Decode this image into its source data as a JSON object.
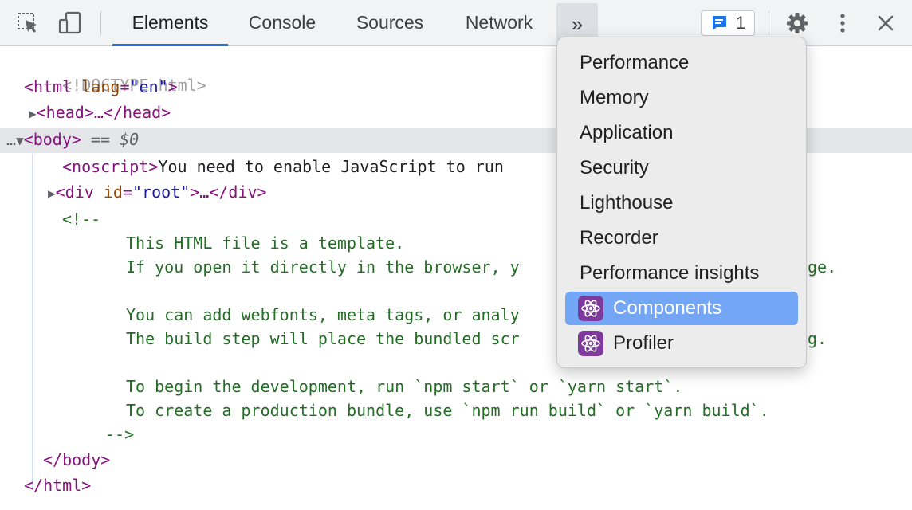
{
  "toolbar": {
    "tabs": [
      "Elements",
      "Console",
      "Sources",
      "Network"
    ],
    "active_tab": "Elements",
    "more_label": "»",
    "issues_count": "1"
  },
  "dom": {
    "doctype": "<!DOCTYPE html>",
    "html_open": "<html",
    "html_attr": "lang",
    "html_val": "\"en\"",
    "html_close_gt": ">",
    "head": "<head>…</head>",
    "body_open": "<body>",
    "body_eq": "== $0",
    "noscript_tag": "<noscript>",
    "noscript_text": "You need to enable JavaScript to run",
    "div_open": "<div",
    "div_attr": "id",
    "div_val": "\"root\"",
    "div_rest": ">…</div>",
    "comment_open": "<!--",
    "comment_lines": [
      "This HTML file is a template.",
      "If you open it directly in the browser, y",
      "ge.",
      "You can add webfonts, meta tags, or analy",
      "The build step will place the bundled scr",
      "g.",
      "To begin the development, run `npm start` or `yarn start`.",
      "To create a production bundle, use `npm run build` or `yarn build`."
    ],
    "comment_close": "-->",
    "body_close": "</body>",
    "html_close": "</html>"
  },
  "menu": {
    "items": [
      {
        "label": "Performance"
      },
      {
        "label": "Memory"
      },
      {
        "label": "Application"
      },
      {
        "label": "Security"
      },
      {
        "label": "Lighthouse"
      },
      {
        "label": "Recorder"
      },
      {
        "label": "Performance insights"
      },
      {
        "label": "Components",
        "icon": "react-atom-icon",
        "highlighted": true
      },
      {
        "label": "Profiler",
        "icon": "react-atom-icon"
      }
    ]
  },
  "colors": {
    "accent": "#1a73e8",
    "menu_highlight": "#73a6f5",
    "tag": "#881280",
    "attr": "#994500",
    "value": "#1a1aa6",
    "comment": "#236e25"
  }
}
